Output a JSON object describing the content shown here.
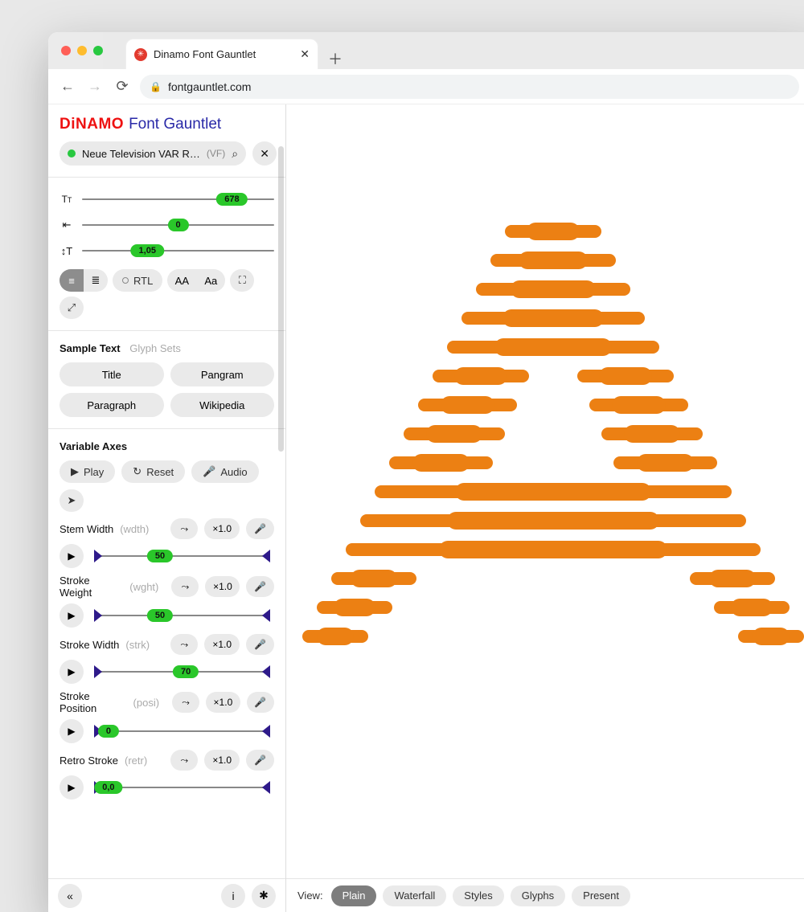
{
  "browser": {
    "tab_title": "Dinamo Font Gauntlet",
    "url": "fontgauntlet.com"
  },
  "brand": {
    "logo": "DiNAMO",
    "suffix": "Font Gauntlet"
  },
  "font": {
    "name": "Neue Television VAR R…",
    "badge": "(VF)"
  },
  "sliders": {
    "size": {
      "value": "678",
      "pos": 78
    },
    "tracking": {
      "value": "0",
      "pos": 50
    },
    "lineheight": {
      "value": "1,05",
      "pos": 34
    }
  },
  "toolbar": {
    "rtl": "RTL",
    "case_upper": "AA",
    "case_mixed": "Aa"
  },
  "sample": {
    "title": "Sample Text",
    "muted": "Glyph Sets",
    "buttons": {
      "title": "Title",
      "pangram": "Pangram",
      "paragraph": "Paragraph",
      "wikipedia": "Wikipedia"
    }
  },
  "axes_section": {
    "title": "Variable Axes",
    "play": "Play",
    "reset": "Reset",
    "audio": "Audio"
  },
  "axes": [
    {
      "name": "Stem Width",
      "tag": "(wdth)",
      "mult": "×1.0",
      "value": "50",
      "pos": 38
    },
    {
      "name": "Stroke Weight",
      "tag": "(wght)",
      "mult": "×1.0",
      "value": "50",
      "pos": 38
    },
    {
      "name": "Stroke Width",
      "tag": "(strk)",
      "mult": "×1.0",
      "value": "70",
      "pos": 52
    },
    {
      "name": "Stroke Position",
      "tag": "(posi)",
      "mult": "×1.0",
      "value": "0",
      "pos": 10
    },
    {
      "name": "Retro Stroke",
      "tag": "(retr)",
      "mult": "×1.0",
      "value": "0,0",
      "pos": 10
    }
  ],
  "view": {
    "label": "View:",
    "options": [
      "Plain",
      "Waterfall",
      "Styles",
      "Glyphs",
      "Present"
    ],
    "active": "Plain"
  }
}
